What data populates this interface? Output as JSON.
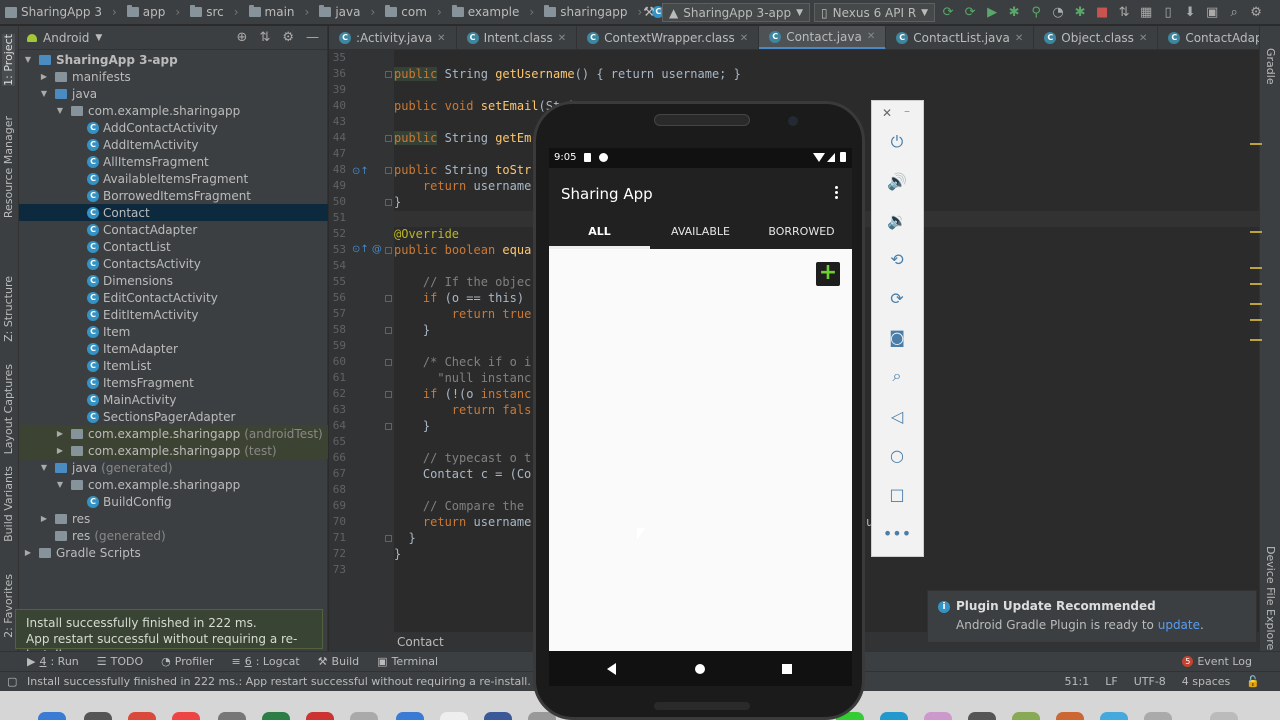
{
  "breadcrumbs": [
    "SharingApp 3",
    "app",
    "src",
    "main",
    "java",
    "com",
    "example",
    "sharingapp",
    "Contact"
  ],
  "toolbar": {
    "run_config": "SharingApp 3-app",
    "device": "Nexus 6 API R"
  },
  "project_panel": {
    "view_mode": "Android",
    "tree": [
      {
        "label": "SharingApp 3-app",
        "depth": 0,
        "twisty": "▼",
        "kind": "project",
        "bold": true
      },
      {
        "label": "manifests",
        "depth": 1,
        "twisty": "▶",
        "kind": "folder"
      },
      {
        "label": "java",
        "depth": 1,
        "twisty": "▼",
        "kind": "folder"
      },
      {
        "label": "com.example.sharingapp",
        "depth": 2,
        "twisty": "▼",
        "kind": "package"
      },
      {
        "label": "AddContactActivity",
        "depth": 3,
        "kind": "class"
      },
      {
        "label": "AddItemActivity",
        "depth": 3,
        "kind": "class"
      },
      {
        "label": "AllItemsFragment",
        "depth": 3,
        "kind": "class"
      },
      {
        "label": "AvailableItemsFragment",
        "depth": 3,
        "kind": "class"
      },
      {
        "label": "BorrowedItemsFragment",
        "depth": 3,
        "kind": "class"
      },
      {
        "label": "Contact",
        "depth": 3,
        "kind": "class",
        "selected": true
      },
      {
        "label": "ContactAdapter",
        "depth": 3,
        "kind": "class"
      },
      {
        "label": "ContactList",
        "depth": 3,
        "kind": "class"
      },
      {
        "label": "ContactsActivity",
        "depth": 3,
        "kind": "class"
      },
      {
        "label": "Dimensions",
        "depth": 3,
        "kind": "class"
      },
      {
        "label": "EditContactActivity",
        "depth": 3,
        "kind": "class"
      },
      {
        "label": "EditItemActivity",
        "depth": 3,
        "kind": "class"
      },
      {
        "label": "Item",
        "depth": 3,
        "kind": "class"
      },
      {
        "label": "ItemAdapter",
        "depth": 3,
        "kind": "class"
      },
      {
        "label": "ItemList",
        "depth": 3,
        "kind": "class"
      },
      {
        "label": "ItemsFragment",
        "depth": 3,
        "kind": "class"
      },
      {
        "label": "MainActivity",
        "depth": 3,
        "kind": "class"
      },
      {
        "label": "SectionsPagerAdapter",
        "depth": 3,
        "kind": "class"
      },
      {
        "label": "com.example.sharingapp",
        "suffix": "(androidTest)",
        "depth": 2,
        "twisty": "▶",
        "kind": "package",
        "highlight": true
      },
      {
        "label": "com.example.sharingapp",
        "suffix": "(test)",
        "depth": 2,
        "twisty": "▶",
        "kind": "package",
        "highlight": true
      },
      {
        "label": "java",
        "suffix": "(generated)",
        "depth": 1,
        "twisty": "▼",
        "kind": "folder"
      },
      {
        "label": "com.example.sharingapp",
        "depth": 2,
        "twisty": "▼",
        "kind": "package"
      },
      {
        "label": "BuildConfig",
        "depth": 3,
        "kind": "class"
      },
      {
        "label": "res",
        "depth": 1,
        "twisty": "▶",
        "kind": "folder"
      },
      {
        "label": "res",
        "suffix": "(generated)",
        "depth": 1,
        "kind": "folder"
      },
      {
        "label": "Gradle Scripts",
        "depth": 0,
        "twisty": "▶",
        "kind": "gradle"
      }
    ]
  },
  "left_stripe": [
    "1: Project",
    "Resource Manager",
    "Z: Structure",
    "Layout Captures",
    "Build Variants",
    "2: Favorites"
  ],
  "right_stripe": [
    "Gradle",
    "Device File Explorer"
  ],
  "editor_tabs": [
    {
      "label": ":Activity.java",
      "icon": "C"
    },
    {
      "label": "Intent.class",
      "icon": "C"
    },
    {
      "label": "ContextWrapper.class",
      "icon": "C"
    },
    {
      "label": "Contact.java",
      "icon": "C",
      "active": true
    },
    {
      "label": "ContactList.java",
      "icon": "C"
    },
    {
      "label": "Object.class",
      "icon": "C"
    },
    {
      "label": "ContactAdapter.java",
      "icon": "C"
    },
    {
      "label": "ContactsActivity.java",
      "icon": "C"
    }
  ],
  "line_numbers": [
    "35",
    "36",
    "39",
    "40",
    "43",
    "44",
    "47",
    "48",
    "49",
    "50",
    "51",
    "52",
    "53",
    "54",
    "55",
    "56",
    "57",
    "58",
    "59",
    "60",
    "61",
    "62",
    "63",
    "64",
    "65",
    "66",
    "67",
    "68",
    "69",
    "70",
    "71",
    "72",
    "73"
  ],
  "code": {
    "l36_kw": "public",
    "l36_type": "String",
    "l36_fn": "getUsername",
    "l36_body": "() { return username; }",
    "l40_kw": "public",
    "l40_type": "void",
    "l40_fn": "setEmail",
    "l40_body": "(Stri",
    "l44_kw": "public",
    "l44_type": "String",
    "l44_fn": "getEm",
    "l48_kw": "public",
    "l48_type": "String",
    "l48_fn": "toStr",
    "l49_kw": "return",
    "l49_body": "username",
    "l50": "}",
    "l52_ann": "@Override",
    "l53_kw": "public",
    "l53_type": "boolean",
    "l53_fn": "equa",
    "l55_cm": "// If the objec",
    "l56_kw": "if",
    "l56_body": "(o == this)",
    "l57_kw": "return",
    "l57_lit": "true",
    "l58": "}",
    "l60_cm": "/* Check if o i",
    "l61_cm": "\"null instanc",
    "l62_kw": "if",
    "l62_body": "(!(o",
    "l62_kw2": "instanc",
    "l63_kw": "return",
    "l63_lit": "fals",
    "l64": "}",
    "l66_cm": "// typecast o t",
    "l67_body": "Contact c = (Co",
    "l69_cm": "// Compare the",
    "l70_kw": "return",
    "l70_body": "username",
    "l70_tail": "u",
    "l70_end": ");",
    "l71": "}",
    "l72": "}"
  },
  "editor_breadcrumb": "Contact",
  "toast": {
    "line1": "Install successfully finished in 222 ms.",
    "line2": "App restart successful without requiring a re-install."
  },
  "notification": {
    "title": "Plugin Update Recommended",
    "body": "Android Gradle Plugin is ready to",
    "link": "update",
    "end": "."
  },
  "bottom_tools": [
    {
      "key": "4",
      "label": ": Run",
      "icon": "▶"
    },
    {
      "key": "",
      "label": "TODO",
      "icon": "☰"
    },
    {
      "key": "",
      "label": "Profiler",
      "icon": "◔"
    },
    {
      "key": "6",
      "label": ": Logcat",
      "icon": "≡"
    },
    {
      "key": "",
      "label": "Build",
      "icon": "⚒"
    },
    {
      "key": "",
      "label": "Terminal",
      "icon": "▣"
    }
  ],
  "event_log": {
    "count": "5",
    "label": "Event Log"
  },
  "status": {
    "message": "Install successfully finished in 222 ms.: App restart successful without requiring a re-install. (a minute ago)",
    "position": "51:1",
    "line_sep": "LF",
    "encoding": "UTF-8",
    "indent": "4 spaces"
  },
  "phone": {
    "time": "9:05",
    "app_title": "Sharing App",
    "tabs": [
      "ALL",
      "AVAILABLE",
      "BORROWED"
    ],
    "fab": "+"
  },
  "colors": {
    "accent_blue": "#4a88c7",
    "fab_green": "#6cd12e",
    "selection": "#0d293e"
  }
}
